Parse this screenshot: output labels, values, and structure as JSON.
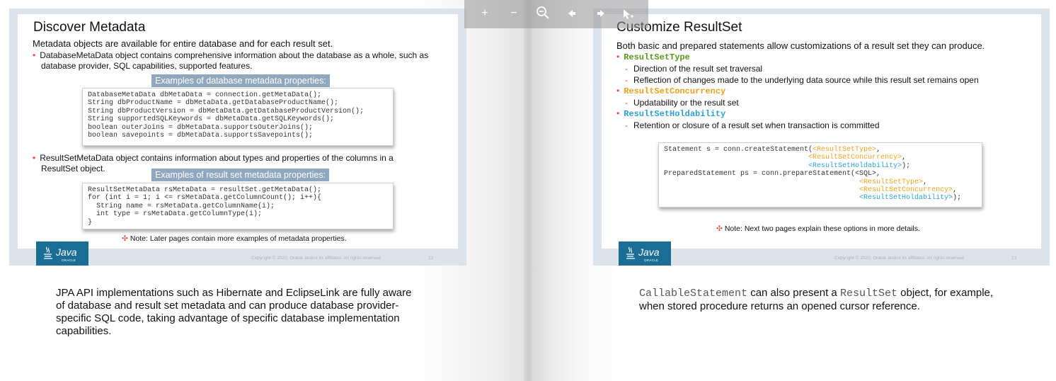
{
  "left_slide": {
    "title": "Discover Metadata",
    "intro": "Metadata objects are available for entire database and for each result set.",
    "bullet1_line1": "DatabaseMetaData object contains comprehensive information about the database as a whole, such as",
    "bullet1_line2": "database provider, SQL capabilities, supported features.",
    "example1_label": "Examples of database metadata properties:",
    "code1": "DatabaseMetaData dbMetaData = connection.getMetaData();\nString dbProductName = dbMetaData.getDatabaseProductName();\nString dbProductVersion = dbMetaData.getDatabaseProductVersion();\nString supportedSQLKeywords = dbMetaData.getSQLKeywords();\nboolean outerJoins = dbMetaData.supportsOuterJoins();\nboolean savepoints = dbMetaData.supportsSavepoints();",
    "bullet2_line1": "ResultSetMetaData object contains information about types and properties of the columns in a",
    "bullet2_line2": "ResultSet object.",
    "example2_label": "Examples of result set metadata properties:",
    "code2": "ResultSetMetaData rsMetaData = resultSet.getMetaData();\nfor (int i = 1; i <= rsMetaData.getColumnCount(); i++){\n  String name = rsMetaData.getColumnName(i);\n  int type = rsMetaData.getColumnType(i);\n}",
    "note": "Note: Later pages contain more examples of metadata properties.",
    "copyright": "Copyright © 2020, Oracle and/or its affiliates. All rights reserved.",
    "page_number": "12"
  },
  "right_slide": {
    "title": "Customize ResultSet",
    "intro": "Both basic and prepared statements allow customizations of a result set they can produce.",
    "type_kw": "ResultSetType",
    "type_sub1": "Direction of the result set traversal",
    "type_sub2": "Reflection of changes made to the underlying data source while this result set remains open",
    "concurrency_kw": "ResultSetConcurrency",
    "concurrency_sub1": "Updatability or the result set",
    "holdability_kw": "ResultSetHoldability",
    "holdability_sub1": "Retention or closure of a result set when transaction is committed",
    "code_line1_a": "Statement s = conn.createStatement(",
    "code_line1_b": "<ResultSetType>",
    "code_line1_c": ",",
    "code_line2": "<ResultSetConcurrency>",
    "code_line2_c": ",",
    "code_line3": "<ResultSetHoldability>",
    "code_line3_c": ");",
    "code_line4": "PreparedStatement ps = conn.prepareStatement(<SQL>,",
    "code_line5": "<ResultSetType>",
    "code_line5_c": ",",
    "code_line6": "<ResultSetConcurrency>",
    "code_line6_c": ",",
    "code_line7": "<ResultSetHoldability>",
    "code_line7_c": ");",
    "note": "Note: Next two pages explain these options in more details.",
    "copyright": "Copyright © 2020, Oracle and/or its affiliates. All rights reserved.",
    "page_number": "13"
  },
  "logo": {
    "word": "Java",
    "sub": "ORACLE"
  },
  "note_marker": "✣",
  "left_caption": {
    "line1": "JPA API implementations such as Hibernate and EclipseLink are fully aware",
    "line2": "of database and result set metadata and can produce database provider-",
    "line3": "specific SQL code, taking advantage of specific database implementation",
    "line4": "capabilities."
  },
  "right_caption": {
    "mono1": "CallableStatement",
    "text1": " can also present a ",
    "mono2": "ResultSet",
    "text2": " object, for example,",
    "line2": "when stored procedure returns an opened cursor reference."
  },
  "toolbar": {
    "zoom_in": "+",
    "zoom_out": "−",
    "zoom_reset_icon": "magnifier-minus-icon",
    "prev_icon": "arrow-left-icon",
    "next_icon": "arrow-right-icon",
    "cursor_icon": "pointer-icon"
  },
  "colors": {
    "accent": "#e0442b",
    "java_blue": "#1a6e96",
    "label_bg": "#8fa7bf",
    "kw_green": "#5a9a1c",
    "kw_orange": "#f0a020",
    "kw_blue": "#2f9fd8"
  }
}
